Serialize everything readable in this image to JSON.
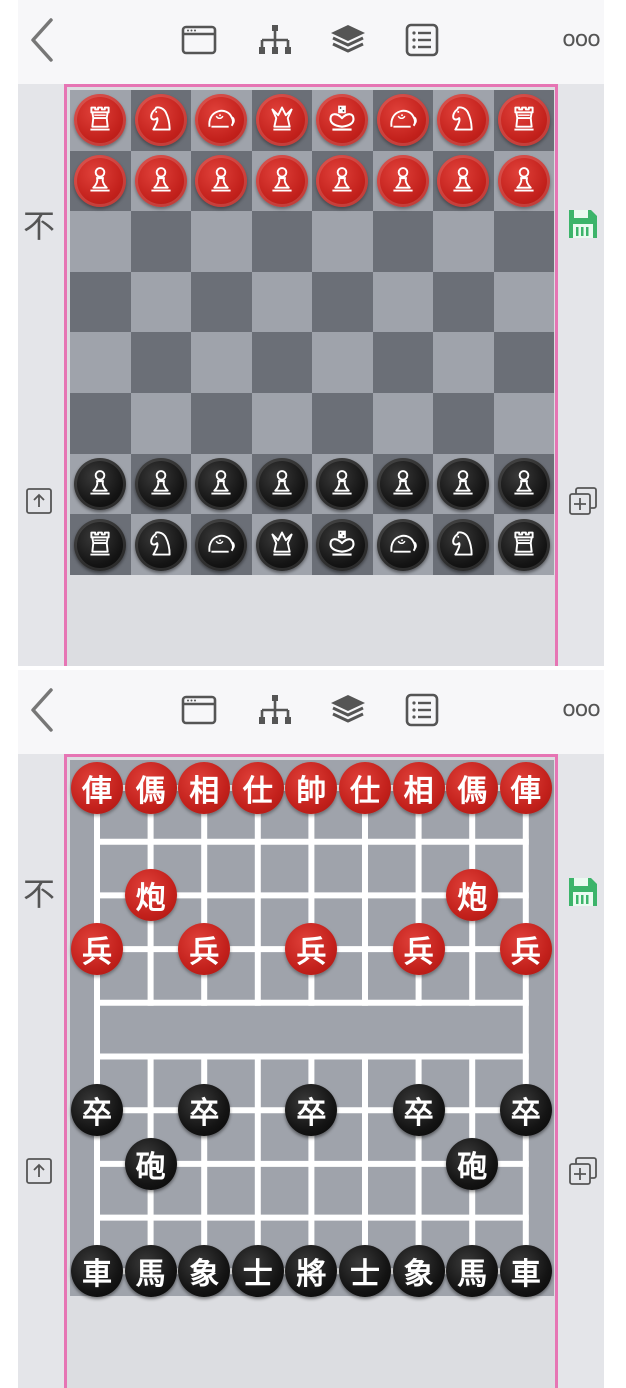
{
  "colors": {
    "accent_border": "#e675b4",
    "save_green": "#3cb46a",
    "icon_gray": "#555555",
    "red_piece": "#c3211c",
    "black_piece": "#141414"
  },
  "toolbar": {
    "back_icon": "chevron-left-icon",
    "window_icon": "browser-window-icon",
    "tree_icon": "hierarchy-icon",
    "layers_icon": "layers-icon",
    "list_icon": "list-icon",
    "more_label": "ooo"
  },
  "side": {
    "top_label": "不",
    "save_icon": "save-icon",
    "upload_icon": "upload-icon",
    "duplicate_icon": "duplicate-icon"
  },
  "chess": {
    "red_back_rank": [
      "rook",
      "knight",
      "elephant",
      "queen",
      "king",
      "elephant",
      "knight",
      "rook"
    ],
    "red_pawns": 8,
    "black_pawns": 8,
    "black_back_rank": [
      "rook",
      "knight",
      "elephant",
      "queen",
      "king",
      "elephant",
      "knight",
      "rook"
    ]
  },
  "xiangqi": {
    "red_back_rank": [
      "俥",
      "傌",
      "相",
      "仕",
      "帥",
      "仕",
      "相",
      "傌",
      "俥"
    ],
    "red_cannon": "炮",
    "red_soldier": "兵",
    "black_soldier": "卒",
    "black_cannon": "砲",
    "black_back_rank": [
      "車",
      "馬",
      "象",
      "士",
      "將",
      "士",
      "象",
      "馬",
      "車"
    ]
  }
}
